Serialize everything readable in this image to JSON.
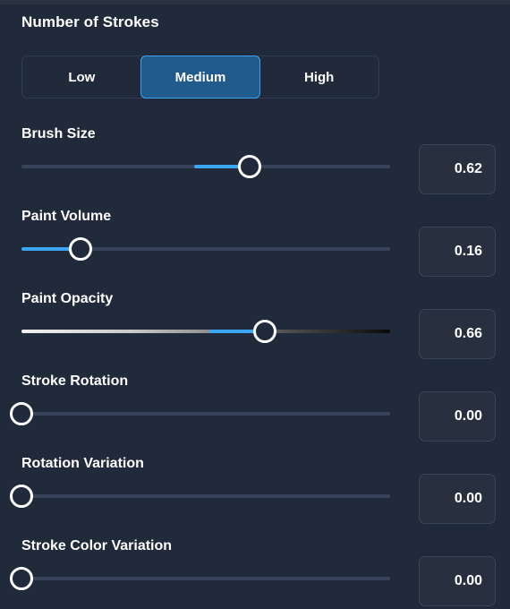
{
  "panel": {
    "section_title": "Number of Strokes",
    "accent_color": "#3da5f5",
    "background_color": "#212a3a"
  },
  "stroke_count": {
    "options": [
      {
        "label": "Low",
        "selected": false
      },
      {
        "label": "Medium",
        "selected": true
      },
      {
        "label": "High",
        "selected": false
      }
    ],
    "selected_label": "Medium"
  },
  "sliders": [
    {
      "label": "Brush Size",
      "value": "0.62",
      "fraction": 0.62,
      "track": "plain",
      "fill": "partial"
    },
    {
      "label": "Paint Volume",
      "value": "0.16",
      "fraction": 0.16,
      "track": "plain",
      "fill": "full"
    },
    {
      "label": "Paint Opacity",
      "value": "0.66",
      "fraction": 0.66,
      "track": "gradient",
      "fill": "partial"
    },
    {
      "label": "Stroke Rotation",
      "value": "0.00",
      "fraction": 0.0,
      "track": "plain",
      "fill": "none"
    },
    {
      "label": "Rotation Variation",
      "value": "0.00",
      "fraction": 0.0,
      "track": "plain",
      "fill": "none"
    },
    {
      "label": "Stroke Color Variation",
      "value": "0.00",
      "fraction": 0.0,
      "track": "plain",
      "fill": "none"
    }
  ]
}
